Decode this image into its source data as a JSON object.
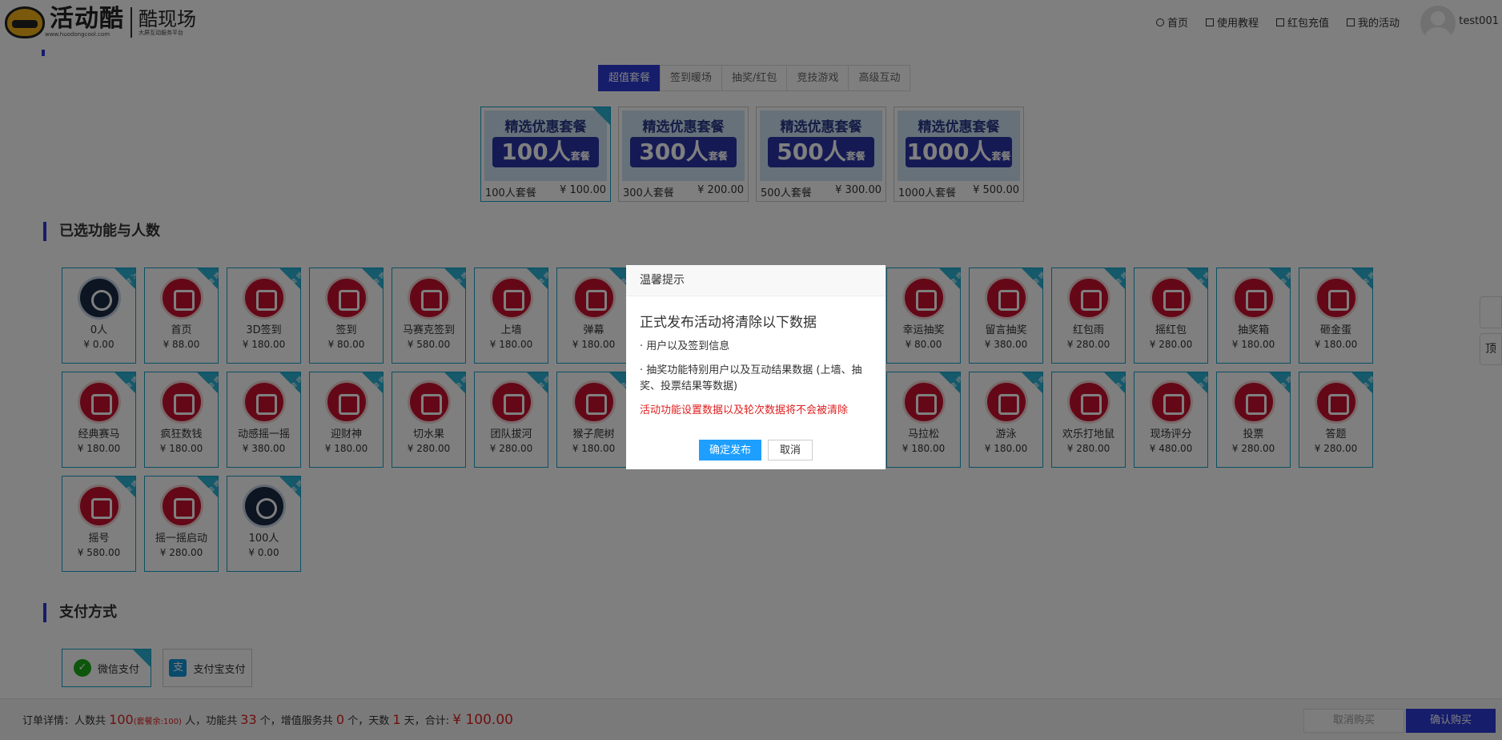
{
  "header": {
    "logo_text": "活动酷",
    "logo_url_text": "www.huodongcool.com",
    "logo_right": "酷现场",
    "logo_right_sub": "大屏互动服务平台",
    "nav": [
      {
        "label": "首页",
        "icon": "home-icon"
      },
      {
        "label": "使用教程",
        "icon": "document-icon"
      },
      {
        "label": "红包充值",
        "icon": "wallet-icon"
      },
      {
        "label": "我的活动",
        "icon": "list-icon"
      }
    ],
    "username": "test001"
  },
  "tabs": [
    "超值套餐",
    "签到暖场",
    "抽奖/红包",
    "竞技游戏",
    "高级互动"
  ],
  "packages": [
    {
      "banner": "精选优惠套餐",
      "count": "100人",
      "suffix": "套餐",
      "name": "100人套餐",
      "price": "¥ 100.00",
      "selected": true
    },
    {
      "banner": "精选优惠套餐",
      "count": "300人",
      "suffix": "套餐",
      "name": "300人套餐",
      "price": "¥ 200.00",
      "selected": false
    },
    {
      "banner": "精选优惠套餐",
      "count": "500人",
      "suffix": "套餐",
      "name": "500人套餐",
      "price": "¥ 300.00",
      "selected": false
    },
    {
      "banner": "精选优惠套餐",
      "count": "1000人",
      "suffix": "套餐",
      "name": "1000人套餐",
      "price": "¥ 500.00",
      "selected": false
    }
  ],
  "features_title": "已选功能与人数",
  "features": [
    {
      "name": "0人",
      "price": "¥ 0.00",
      "icon": "user-icon",
      "tag": "人数"
    },
    {
      "name": "首页",
      "price": "¥ 88.00",
      "icon": "home-icon",
      "tag": "套餐"
    },
    {
      "name": "3D签到",
      "price": "¥ 180.00",
      "icon": "globe-icon",
      "tag": "套餐"
    },
    {
      "name": "签到",
      "price": "¥ 80.00",
      "icon": "calendar-check-icon",
      "tag": "套餐"
    },
    {
      "name": "马赛克签到",
      "price": "¥ 580.00",
      "icon": "calendar-icon",
      "tag": "套餐"
    },
    {
      "name": "上墙",
      "price": "¥ 180.00",
      "icon": "chat-icon",
      "tag": "套餐"
    },
    {
      "name": "弹幕",
      "price": "¥ 180.00",
      "icon": "chat-bubble-icon",
      "tag": "套餐"
    },
    {
      "name": "",
      "price": "",
      "icon": "hidden-icon",
      "tag": ""
    },
    {
      "name": "",
      "price": "",
      "icon": "hidden-icon",
      "tag": ""
    },
    {
      "name": "",
      "price": "",
      "icon": "hidden-icon",
      "tag": ""
    },
    {
      "name": "幸运抽奖",
      "price": "¥ 80.00",
      "icon": "gift-icon",
      "tag": "套餐"
    },
    {
      "name": "留言抽奖",
      "price": "¥ 380.00",
      "icon": "note-icon",
      "tag": "套餐"
    },
    {
      "name": "红包雨",
      "price": "¥ 280.00",
      "icon": "red-envelope-icon",
      "tag": "套餐"
    },
    {
      "name": "摇红包",
      "price": "¥ 280.00",
      "icon": "phone-shake-icon",
      "tag": "套餐"
    },
    {
      "name": "抽奖箱",
      "price": "¥ 180.00",
      "icon": "box-icon",
      "tag": "套餐"
    },
    {
      "name": "砸金蛋",
      "price": "¥ 180.00",
      "icon": "egg-hammer-icon",
      "tag": "套餐"
    },
    {
      "name": "经典赛马",
      "price": "¥ 180.00",
      "icon": "horse-icon",
      "tag": "套餐"
    },
    {
      "name": "疯狂数钱",
      "price": "¥ 180.00",
      "icon": "money-hand-icon",
      "tag": "套餐"
    },
    {
      "name": "动感摇一摇",
      "price": "¥ 380.00",
      "icon": "shake-icon",
      "tag": "套餐"
    },
    {
      "name": "迎财神",
      "price": "¥ 180.00",
      "icon": "coin-icon",
      "tag": "套餐"
    },
    {
      "name": "切水果",
      "price": "¥ 280.00",
      "icon": "fruit-icon",
      "tag": "套餐"
    },
    {
      "name": "团队拔河",
      "price": "¥ 280.00",
      "icon": "tug-of-war-icon",
      "tag": "套餐"
    },
    {
      "name": "猴子爬树",
      "price": "¥ 180.00",
      "icon": "monkey-icon",
      "tag": "套餐"
    },
    {
      "name": "",
      "price": "",
      "icon": "hidden-icon",
      "tag": ""
    },
    {
      "name": "",
      "price": "",
      "icon": "hidden-icon",
      "tag": ""
    },
    {
      "name": "",
      "price": "",
      "icon": "hidden-icon",
      "tag": ""
    },
    {
      "name": "马拉松",
      "price": "¥ 180.00",
      "icon": "runner-icon",
      "tag": "套餐"
    },
    {
      "name": "游泳",
      "price": "¥ 180.00",
      "icon": "swim-icon",
      "tag": "套餐"
    },
    {
      "name": "欢乐打地鼠",
      "price": "¥ 280.00",
      "icon": "mole-icon",
      "tag": "套餐"
    },
    {
      "name": "现场评分",
      "price": "¥ 480.00",
      "icon": "thumbs-up-icon",
      "tag": "套餐"
    },
    {
      "name": "投票",
      "price": "¥ 280.00",
      "icon": "bar-chart-icon",
      "tag": "套餐"
    },
    {
      "name": "答题",
      "price": "¥ 280.00",
      "icon": "answer-icon",
      "tag": "套餐"
    },
    {
      "name": "摇号",
      "price": "¥ 580.00",
      "icon": "lottery-icon",
      "tag": "套餐"
    },
    {
      "name": "摇一摇启动",
      "price": "¥ 280.00",
      "icon": "launch-icon",
      "tag": "套餐"
    },
    {
      "name": "100人",
      "price": "¥ 0.00",
      "icon": "user-icon",
      "tag": "套餐"
    }
  ],
  "payment_title": "支付方式",
  "payments": [
    {
      "label": "微信支付",
      "icon": "wechat-pay-icon",
      "selected": true
    },
    {
      "label": "支付宝支付",
      "icon": "alipay-icon",
      "selected": false
    }
  ],
  "order": {
    "prefix": "订单详情：人数共",
    "people": "100",
    "people_note": "(套餐余:100)",
    "people_unit": "人，功能共",
    "features": "33",
    "features_unit": "个，增值服务共",
    "services": "0",
    "services_unit": "个，天数",
    "days": "1",
    "days_unit": "天，合计:",
    "total": "¥ 100.00"
  },
  "bottom_buttons": {
    "cancel": "取消购买",
    "confirm": "确认购买"
  },
  "side_tools": [
    "",
    "顶"
  ],
  "dialog": {
    "header": "温馨提示",
    "title": "正式发布活动将清除以下数据",
    "line1": "· 用户以及签到信息",
    "line2": "· 抽奖功能特别用户以及互动结果数据 (上墙、抽奖、投票结果等数据)",
    "warning": "活动功能设置数据以及轮次数据将不会被清除",
    "confirm": "确定发布",
    "cancel": "取消"
  }
}
